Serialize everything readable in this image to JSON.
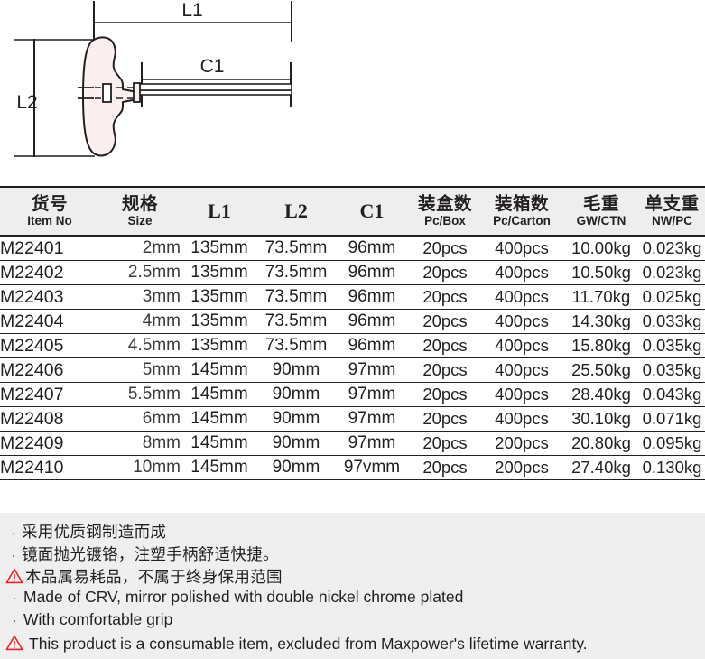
{
  "drawing": {
    "labels": {
      "l1": "L1",
      "l2": "L2",
      "c1": "C1"
    },
    "colors": {
      "line": "#231f20",
      "handle_fill": "#fbf0ef",
      "shaft_fill": "#ffffff"
    },
    "alt": "T-handle hex key technical drawing with L1, L2 and C1 dimension callouts"
  },
  "table": {
    "header": [
      {
        "cn": "货号",
        "en": "Item No",
        "symbol": ""
      },
      {
        "cn": "规格",
        "en": "Size",
        "symbol": ""
      },
      {
        "cn": "",
        "en": "",
        "symbol": "L1"
      },
      {
        "cn": "",
        "en": "",
        "symbol": "L2"
      },
      {
        "cn": "",
        "en": "",
        "symbol": "C1"
      },
      {
        "cn": "装盒数",
        "en": "Pc/Box",
        "symbol": ""
      },
      {
        "cn": "装箱数",
        "en": "Pc/Carton",
        "symbol": ""
      },
      {
        "cn": "毛重",
        "en": "GW/CTN",
        "symbol": ""
      },
      {
        "cn": "单支重",
        "en": "NW/PC",
        "symbol": ""
      }
    ],
    "rows": [
      {
        "item": "M22401",
        "size": "2mm",
        "l1": "135mm",
        "l2": "73.5mm",
        "c1": "96mm",
        "box": "20pcs",
        "carton": "400pcs",
        "gw": "10.00kg",
        "nw": "0.023kg"
      },
      {
        "item": "M22402",
        "size": "2.5mm",
        "l1": "135mm",
        "l2": "73.5mm",
        "c1": "96mm",
        "box": "20pcs",
        "carton": "400pcs",
        "gw": "10.50kg",
        "nw": "0.023kg"
      },
      {
        "item": "M22403",
        "size": "3mm",
        "l1": "135mm",
        "l2": "73.5mm",
        "c1": "96mm",
        "box": "20pcs",
        "carton": "400pcs",
        "gw": "11.70kg",
        "nw": "0.025kg"
      },
      {
        "item": "M22404",
        "size": "4mm",
        "l1": "135mm",
        "l2": "73.5mm",
        "c1": "96mm",
        "box": "20pcs",
        "carton": "400pcs",
        "gw": "14.30kg",
        "nw": "0.033kg"
      },
      {
        "item": "M22405",
        "size": "4.5mm",
        "l1": "135mm",
        "l2": "73.5mm",
        "c1": "96mm",
        "box": "20pcs",
        "carton": "400pcs",
        "gw": "15.80kg",
        "nw": "0.035kg"
      },
      {
        "item": "M22406",
        "size": "5mm",
        "l1": "145mm",
        "l2": "90mm",
        "c1": "97mm",
        "box": "20pcs",
        "carton": "400pcs",
        "gw": "25.50kg",
        "nw": "0.035kg"
      },
      {
        "item": "M22407",
        "size": "5.5mm",
        "l1": "145mm",
        "l2": "90mm",
        "c1": "97mm",
        "box": "20pcs",
        "carton": "400pcs",
        "gw": "28.40kg",
        "nw": "0.043kg"
      },
      {
        "item": "M22408",
        "size": "6mm",
        "l1": "145mm",
        "l2": "90mm",
        "c1": "97mm",
        "box": "20pcs",
        "carton": "400pcs",
        "gw": "30.10kg",
        "nw": "0.071kg"
      },
      {
        "item": "M22409",
        "size": "8mm",
        "l1": "145mm",
        "l2": "90mm",
        "c1": "97mm",
        "box": "20pcs",
        "carton": "200pcs",
        "gw": "20.80kg",
        "nw": "0.095kg"
      },
      {
        "item": "M22410",
        "size": "10mm",
        "l1": "145mm",
        "l2": "90mm",
        "c1": "97vmm",
        "box": "20pcs",
        "carton": "200pcs",
        "gw": "27.40kg",
        "nw": "0.130kg"
      }
    ]
  },
  "notes": {
    "warning_color": "#e8252a",
    "items": [
      {
        "marker": "bullet",
        "lang": "cn",
        "text": "采用优质钢制造而成"
      },
      {
        "marker": "bullet",
        "lang": "cn",
        "text": "镜面抛光镀铬，注塑手柄舒适快捷。"
      },
      {
        "marker": "warning",
        "lang": "cn",
        "text": "本品属易耗品，不属于终身保用范围"
      },
      {
        "marker": "bullet",
        "lang": "en",
        "text": "Made of CRV, mirror polished with double nickel chrome plated"
      },
      {
        "marker": "bullet",
        "lang": "en",
        "text": "With comfortable grip"
      },
      {
        "marker": "warning",
        "lang": "en",
        "text": "This product is a consumable item, excluded from Maxpower's lifetime warranty."
      }
    ]
  }
}
